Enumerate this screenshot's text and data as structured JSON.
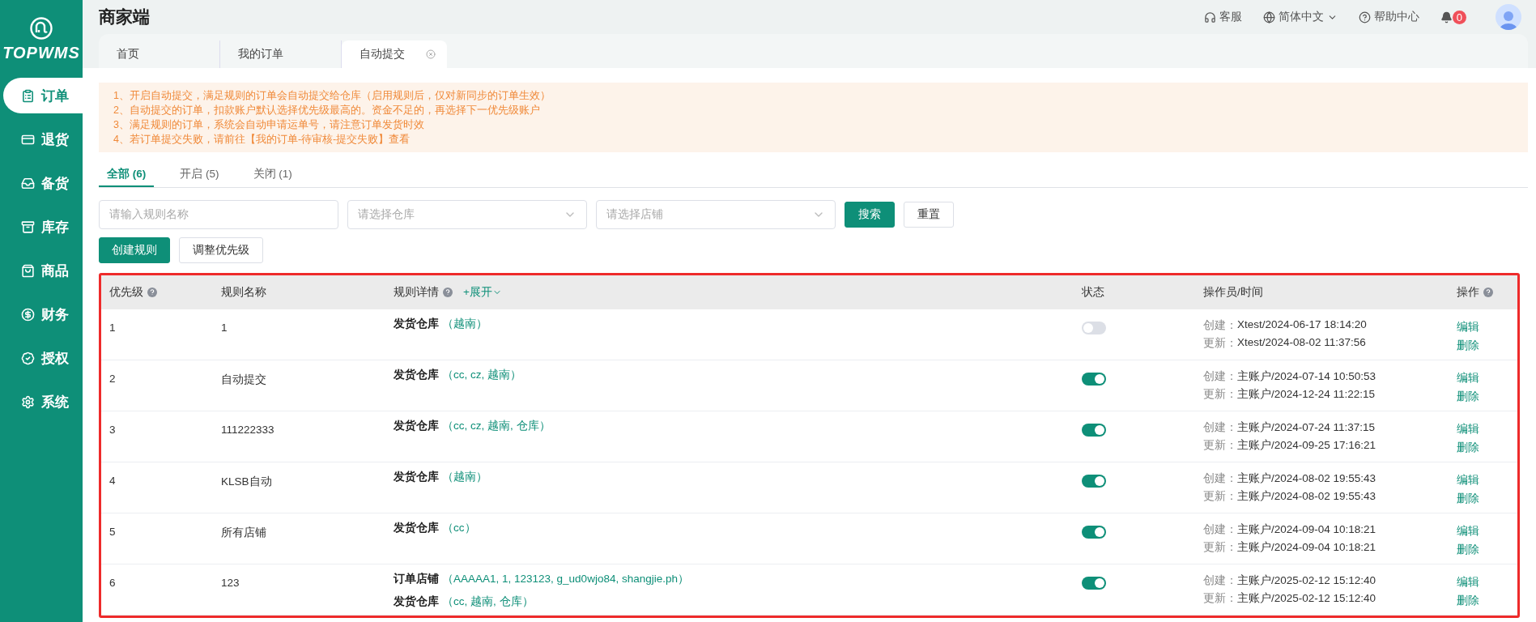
{
  "brand": {
    "name": "TOPWMS"
  },
  "sidebar": {
    "items": [
      {
        "label": "订单",
        "selected": true
      },
      {
        "label": "退货",
        "selected": false
      },
      {
        "label": "备货",
        "selected": false
      },
      {
        "label": "库存",
        "selected": false
      },
      {
        "label": "商品",
        "selected": false
      },
      {
        "label": "财务",
        "selected": false
      },
      {
        "label": "授权",
        "selected": false
      },
      {
        "label": "系统",
        "selected": false
      }
    ]
  },
  "header": {
    "title": "商家端",
    "service": "客服",
    "language": "简体中文",
    "help": "帮助中心",
    "notifications": "0"
  },
  "page_tabs": [
    {
      "label": "首页",
      "selected": false,
      "closable": false
    },
    {
      "label": "我的订单",
      "selected": false,
      "closable": false
    },
    {
      "label": "自动提交",
      "selected": true,
      "closable": true
    }
  ],
  "notice": [
    "1、开启自动提交，满足规则的订单会自动提交给仓库（启用规则后，仅对新同步的订单生效）",
    "2、自动提交的订单，扣款账户默认选择优先级最高的。资金不足的，再选择下一优先级账户",
    "3、满足规则的订单，系统会自动申请运单号，请注意订单发货时效",
    "4、若订单提交失败，请前往【我的订单-待审核-提交失败】查看"
  ],
  "status_tabs": [
    {
      "label": "全部 (6)",
      "selected": true
    },
    {
      "label": "开启 (5)",
      "selected": false
    },
    {
      "label": "关闭 (1)",
      "selected": false
    }
  ],
  "filters": [
    {
      "kind": "input",
      "placeholder": "请输入规则名称"
    },
    {
      "kind": "select",
      "placeholder": "请选择仓库"
    },
    {
      "kind": "select",
      "placeholder": "请选择店铺"
    }
  ],
  "filter_buttons": [
    {
      "label": "搜索",
      "primary": true
    },
    {
      "label": "重置",
      "primary": false
    }
  ],
  "action_buttons": [
    {
      "label": "创建规则",
      "primary": true
    },
    {
      "label": "调整优先级",
      "primary": false
    }
  ],
  "table": {
    "highlighted": true,
    "columns": [
      {
        "label": "优先级",
        "help": true
      },
      {
        "label": "规则名称",
        "help": false
      },
      {
        "label": "规则详情",
        "help": true,
        "expand": "+展开"
      },
      {
        "label": "状态",
        "help": false
      },
      {
        "label": "操作员/时间",
        "help": false
      },
      {
        "label": "操作",
        "help": true
      }
    ],
    "rows": [
      {
        "priority": "1",
        "name": "1",
        "details": [
          {
            "label": "发货仓库",
            "value": "（越南）"
          }
        ],
        "on": false,
        "created_label": "创建：",
        "created": "Xtest/2024-06-17 18:14:20",
        "updated_label": "更新：",
        "updated": "Xtest/2024-08-02 11:37:56",
        "actions": [
          "编辑",
          "删除"
        ]
      },
      {
        "priority": "2",
        "name": "自动提交",
        "details": [
          {
            "label": "发货仓库",
            "value": "（cc, cz, 越南）"
          }
        ],
        "on": true,
        "created_label": "创建：",
        "created": "主账户/2024-07-14 10:50:53",
        "updated_label": "更新：",
        "updated": "主账户/2024-12-24 11:22:15",
        "actions": [
          "编辑",
          "删除"
        ]
      },
      {
        "priority": "3",
        "name": "111222333",
        "details": [
          {
            "label": "发货仓库",
            "value": "（cc, cz, 越南, 仓库）"
          }
        ],
        "on": true,
        "created_label": "创建：",
        "created": "主账户/2024-07-24 11:37:15",
        "updated_label": "更新：",
        "updated": "主账户/2024-09-25 17:16:21",
        "actions": [
          "编辑",
          "删除"
        ]
      },
      {
        "priority": "4",
        "name": "KLSB自动",
        "details": [
          {
            "label": "发货仓库",
            "value": "（越南）"
          }
        ],
        "on": true,
        "created_label": "创建：",
        "created": "主账户/2024-08-02 19:55:43",
        "updated_label": "更新：",
        "updated": "主账户/2024-08-02 19:55:43",
        "actions": [
          "编辑",
          "删除"
        ]
      },
      {
        "priority": "5",
        "name": "所有店铺",
        "details": [
          {
            "label": "发货仓库",
            "value": "（cc）"
          }
        ],
        "on": true,
        "created_label": "创建：",
        "created": "主账户/2024-09-04 10:18:21",
        "updated_label": "更新：",
        "updated": "主账户/2024-09-04 10:18:21",
        "actions": [
          "编辑",
          "删除"
        ]
      },
      {
        "priority": "6",
        "name": "123",
        "details": [
          {
            "label": "订单店铺",
            "value": "（AAAAA1, 1, 123123, g_ud0wjo84, shangjie.ph）"
          },
          {
            "label": "发货仓库",
            "value": "（cc, 越南, 仓库）"
          }
        ],
        "on": true,
        "created_label": "创建：",
        "created": "主账户/2025-02-12 15:12:40",
        "updated_label": "更新：",
        "updated": "主账户/2025-02-12 15:12:40",
        "actions": [
          "编辑",
          "删除"
        ]
      }
    ]
  }
}
